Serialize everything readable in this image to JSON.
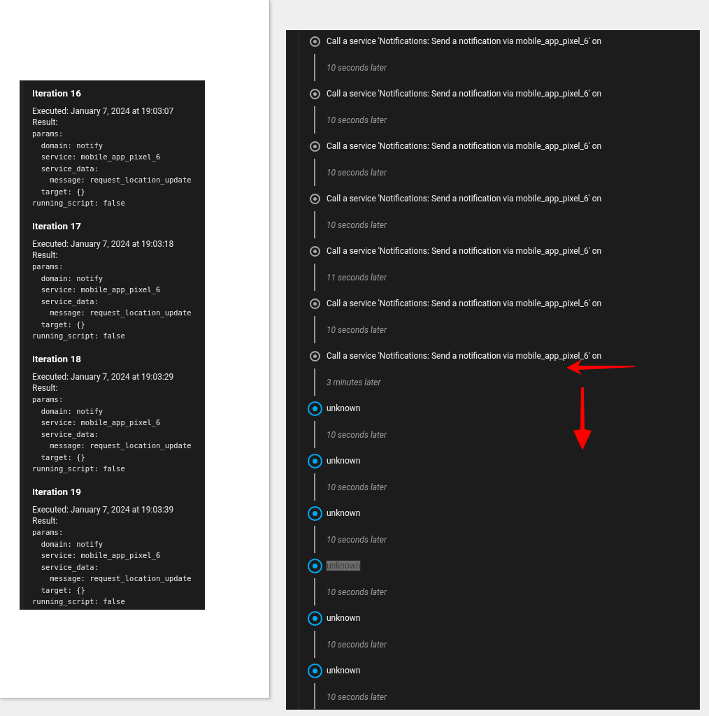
{
  "iterations": [
    {
      "title": "Iteration 16",
      "executed": "Executed: January 7, 2024 at 19:03:07",
      "result_label": "Result:",
      "result_lines": [
        "params:",
        "  domain: notify",
        "  service: mobile_app_pixel_6",
        "  service_data:",
        "    message: request_location_update",
        "  target: {}",
        "running_script: false"
      ]
    },
    {
      "title": "Iteration 17",
      "executed": "Executed: January 7, 2024 at 19:03:18",
      "result_label": "Result:",
      "result_lines": [
        "params:",
        "  domain: notify",
        "  service: mobile_app_pixel_6",
        "  service_data:",
        "    message: request_location_update",
        "  target: {}",
        "running_script: false"
      ]
    },
    {
      "title": "Iteration 18",
      "executed": "Executed: January 7, 2024 at 19:03:29",
      "result_label": "Result:",
      "result_lines": [
        "params:",
        "  domain: notify",
        "  service: mobile_app_pixel_6",
        "  service_data:",
        "    message: request_location_update",
        "  target: {}",
        "running_script: false"
      ]
    },
    {
      "title": "Iteration 19",
      "executed": "Executed: January 7, 2024 at 19:03:39",
      "result_label": "Result:",
      "result_lines": [
        "params:",
        "  domain: notify",
        "  service: mobile_app_pixel_6",
        "  service_data:",
        "    message: request_location_update",
        "  target: {}",
        "running_script: false"
      ]
    }
  ],
  "timeline": [
    {
      "kind": "service",
      "label": "Call a service 'Notifications: Send a notification via mobile_app_pixel_6' on",
      "highlighted": false,
      "delay": "10 seconds later"
    },
    {
      "kind": "service",
      "label": "Call a service 'Notifications: Send a notification via mobile_app_pixel_6' on",
      "highlighted": false,
      "delay": "10 seconds later"
    },
    {
      "kind": "service",
      "label": "Call a service 'Notifications: Send a notification via mobile_app_pixel_6' on",
      "highlighted": false,
      "delay": "10 seconds later"
    },
    {
      "kind": "service",
      "label": "Call a service 'Notifications: Send a notification via mobile_app_pixel_6' on",
      "highlighted": false,
      "delay": "10 seconds later"
    },
    {
      "kind": "service",
      "label": "Call a service 'Notifications: Send a notification via mobile_app_pixel_6' on",
      "highlighted": false,
      "delay": "11 seconds later"
    },
    {
      "kind": "service",
      "label": "Call a service 'Notifications: Send a notification via mobile_app_pixel_6' on",
      "highlighted": false,
      "delay": "10 seconds later"
    },
    {
      "kind": "service",
      "label": "Call a service 'Notifications: Send a notification via mobile_app_pixel_6' on",
      "highlighted": false,
      "delay": "3 minutes later"
    },
    {
      "kind": "state",
      "label": "unknown",
      "highlighted": false,
      "delay": "10 seconds later"
    },
    {
      "kind": "state",
      "label": "unknown",
      "highlighted": false,
      "delay": "10 seconds later"
    },
    {
      "kind": "state",
      "label": "unknown",
      "highlighted": false,
      "delay": "10 seconds later"
    },
    {
      "kind": "state",
      "label": "unknown",
      "highlighted": true,
      "delay": "10 seconds later"
    },
    {
      "kind": "state",
      "label": "unknown",
      "highlighted": false,
      "delay": "10 seconds later"
    },
    {
      "kind": "state",
      "label": "unknown",
      "highlighted": false,
      "delay": "10 seconds later"
    }
  ],
  "annotations": [
    {
      "kind": "left"
    },
    {
      "kind": "down"
    }
  ]
}
